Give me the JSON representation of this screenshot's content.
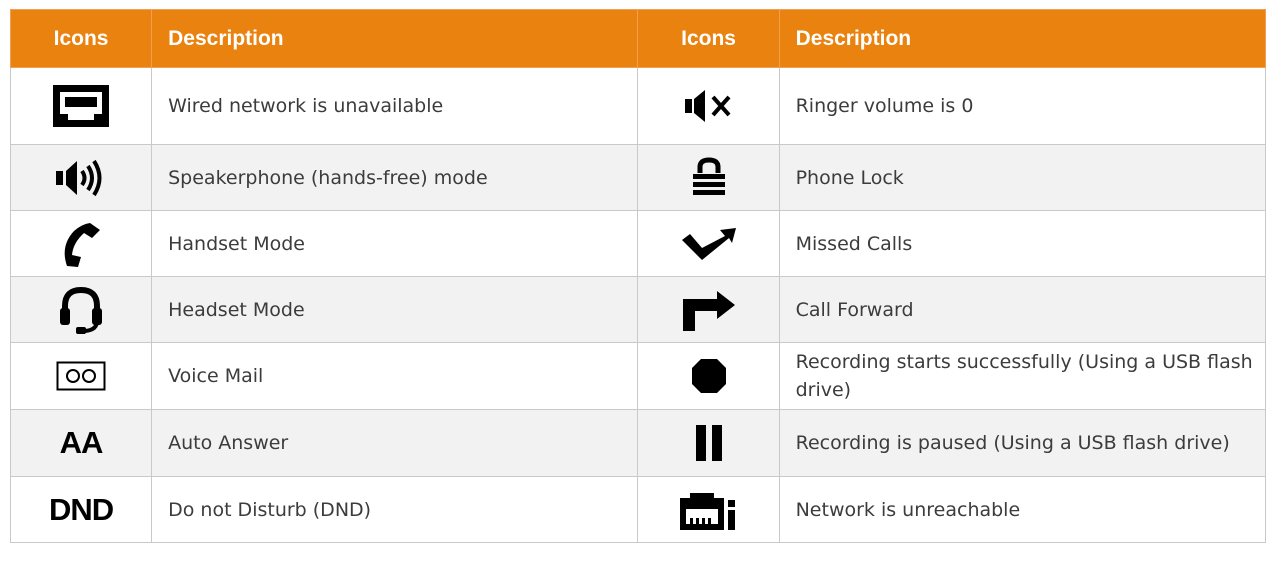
{
  "table": {
    "headers": [
      "Icons",
      "Description",
      "Icons",
      "Description"
    ],
    "rows": [
      {
        "left": {
          "icon": "wired-network-unavailable-icon",
          "description": "Wired network is unavailable"
        },
        "right": {
          "icon": "ringer-mute-icon",
          "description": "Ringer volume is 0"
        }
      },
      {
        "left": {
          "icon": "speakerphone-icon",
          "description": "Speakerphone (hands-free) mode"
        },
        "right": {
          "icon": "lock-icon",
          "description": "Phone Lock"
        }
      },
      {
        "left": {
          "icon": "handset-icon",
          "description": "Handset Mode"
        },
        "right": {
          "icon": "missed-call-icon",
          "description": "Missed Calls"
        }
      },
      {
        "left": {
          "icon": "headset-icon",
          "description": "Headset Mode"
        },
        "right": {
          "icon": "call-forward-icon",
          "description": "Call Forward"
        }
      },
      {
        "left": {
          "icon": "voicemail-icon",
          "description": "Voice Mail"
        },
        "right": {
          "icon": "record-icon",
          "description": "Recording starts successfully (Using a USB flash drive)"
        }
      },
      {
        "left": {
          "icon": "auto-answer-icon",
          "icon_text": "AA",
          "description": "Auto Answer"
        },
        "right": {
          "icon": "pause-icon",
          "description": "Recording is paused (Using a USB flash drive)"
        }
      },
      {
        "left": {
          "icon": "dnd-icon",
          "icon_text": "DND",
          "description": "Do not Disturb (DND)"
        },
        "right": {
          "icon": "network-unreachable-icon",
          "description": "Network is unreachable"
        }
      }
    ]
  },
  "colors": {
    "header_bg": "#ea8210",
    "header_text": "#ffffff",
    "alt_row": "#f2f2f2",
    "border": "#c9c9c9"
  }
}
